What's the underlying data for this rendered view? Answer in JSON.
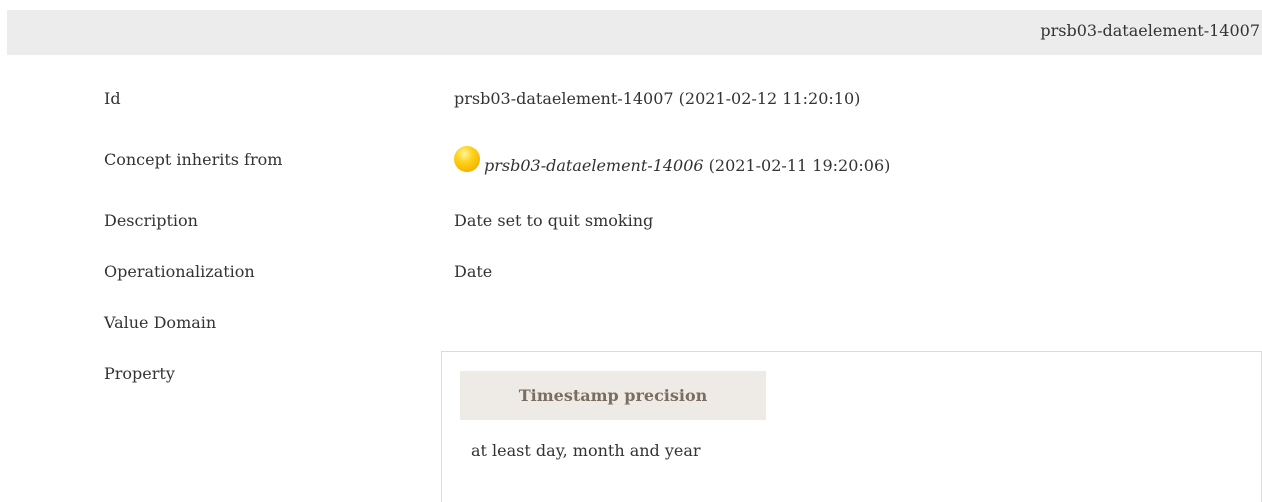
{
  "header": {
    "title": "prsb03-dataelement-14007"
  },
  "rows": {
    "id": {
      "label": "Id",
      "value": "prsb03-dataelement-14007 (2021-02-12 11:20:10)"
    },
    "inherits": {
      "label": "Concept inherits from",
      "status_icon": "yellow-status-dot-icon",
      "id": "prsb03-dataelement-14006",
      "date": " (2021-02-11 19:20:06)"
    },
    "description": {
      "label": "Description",
      "value": "Date set to quit smoking"
    },
    "operationalization": {
      "label": "Operationalization",
      "value": "Date"
    },
    "value_domain": {
      "label": "Value Domain"
    },
    "property": {
      "label": "Property",
      "header": "Timestamp precision",
      "value": "at least day, month and year"
    }
  },
  "colors": {
    "header_bg": "#ececec",
    "property_header_bg": "#eeebe6",
    "property_header_text": "#7a6e60",
    "status_dot": "#f5b800"
  }
}
